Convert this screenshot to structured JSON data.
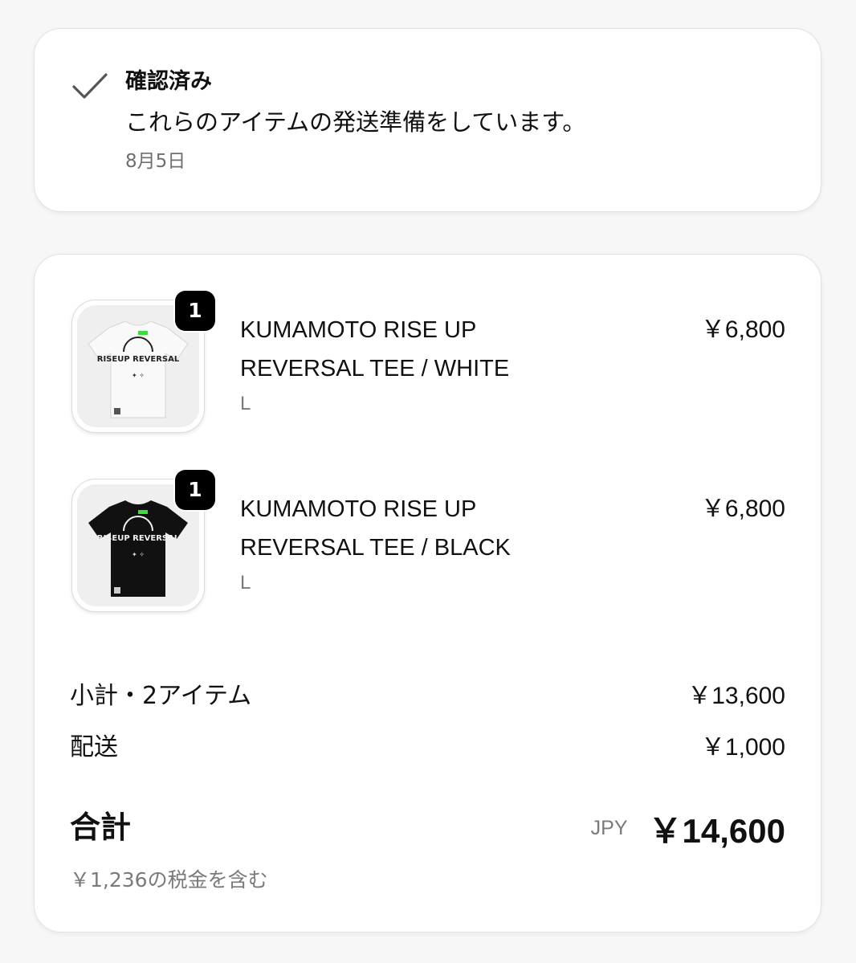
{
  "status": {
    "icon": "check-icon",
    "title": "確認済み",
    "message": "これらのアイテムの発送準備をしています。",
    "date": "8月5日"
  },
  "items": [
    {
      "quantity": "1",
      "name_line1": "KUMAMOTO RISE UP",
      "name_line2": "REVERSAL TEE / WHITE",
      "variant": "L",
      "price": "￥6,800",
      "shirt_color": "#f4f4f4",
      "print_color": "#222222",
      "print_text": "RISEUP REVERSAL"
    },
    {
      "quantity": "1",
      "name_line1": "KUMAMOTO RISE UP",
      "name_line2": "REVERSAL TEE / BLACK",
      "variant": "L",
      "price": "￥6,800",
      "shirt_color": "#111111",
      "print_color": "#f2f2f2",
      "print_text": "RISEUP REVERSAL"
    }
  ],
  "summary": {
    "subtotal_label": "小計・2アイテム",
    "subtotal_value": "￥13,600",
    "shipping_label": "配送",
    "shipping_value": "￥1,000",
    "total_label": "合計",
    "currency": "JPY",
    "total_value": "￥14,600",
    "tax_note": "￥1,236の税金を含む"
  },
  "colors": {
    "accent_green": "#3ddc3d",
    "muted_text": "#7a7a7a"
  }
}
